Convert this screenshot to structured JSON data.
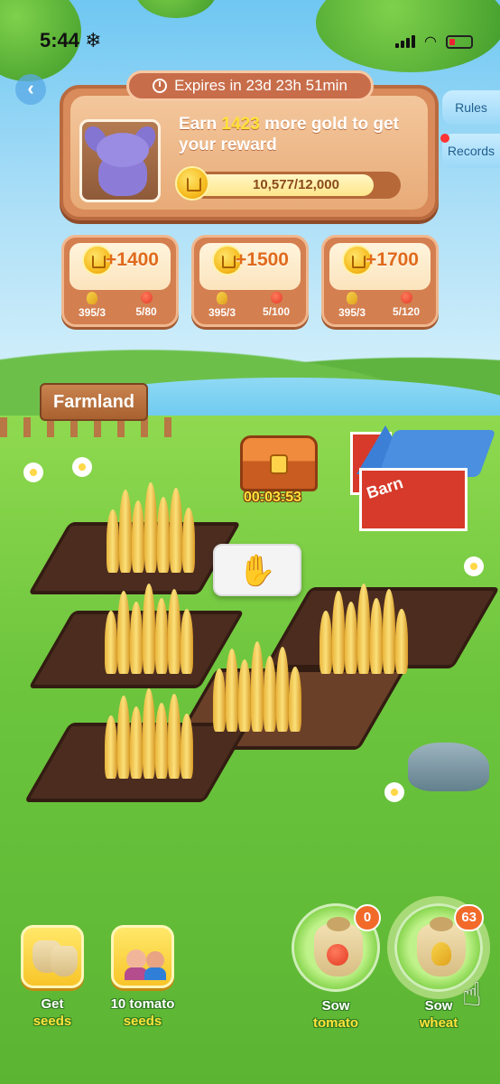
{
  "status_bar": {
    "time": "5:44",
    "extra_icon": "snowflake-icon"
  },
  "nav": {
    "back_icon": "chevron-left-icon"
  },
  "reward": {
    "expires_label": "Expires in 23d 23h 51min",
    "earn_prefix": "Earn ",
    "earn_amount": "1423",
    "earn_suffix": " more gold to get your reward",
    "progress_text": "10,577/12,000",
    "progress_value": 10577,
    "progress_max": 12000,
    "prize_image": "purple-plush-toy"
  },
  "side_buttons": {
    "rules": "Rules",
    "records": "Records"
  },
  "milestones": [
    {
      "gold": "+1400",
      "wheat": "395/3",
      "tomato": "5/80"
    },
    {
      "gold": "+1500",
      "wheat": "395/3",
      "tomato": "5/100"
    },
    {
      "gold": "+1700",
      "wheat": "395/3",
      "tomato": "5/120"
    }
  ],
  "farm": {
    "sign": "Farmland",
    "chest_timer": "00:03:53",
    "barn_label": "Barn",
    "hand_icon": "hand-tap-icon"
  },
  "actions": {
    "get_seeds": {
      "line1": "Get",
      "line2": "seeds"
    },
    "tomato_seeds": {
      "line1": "10 tomato",
      "line2": "seeds"
    },
    "sow_tomato": {
      "line1": "Sow",
      "line2": "tomato",
      "count": "0"
    },
    "sow_wheat": {
      "line1": "Sow",
      "line2": "wheat",
      "count": "63"
    }
  },
  "colors": {
    "accent_gold": "#ffe23a",
    "panel_brown": "#d98b5b",
    "badge_orange": "#f26a2a"
  }
}
